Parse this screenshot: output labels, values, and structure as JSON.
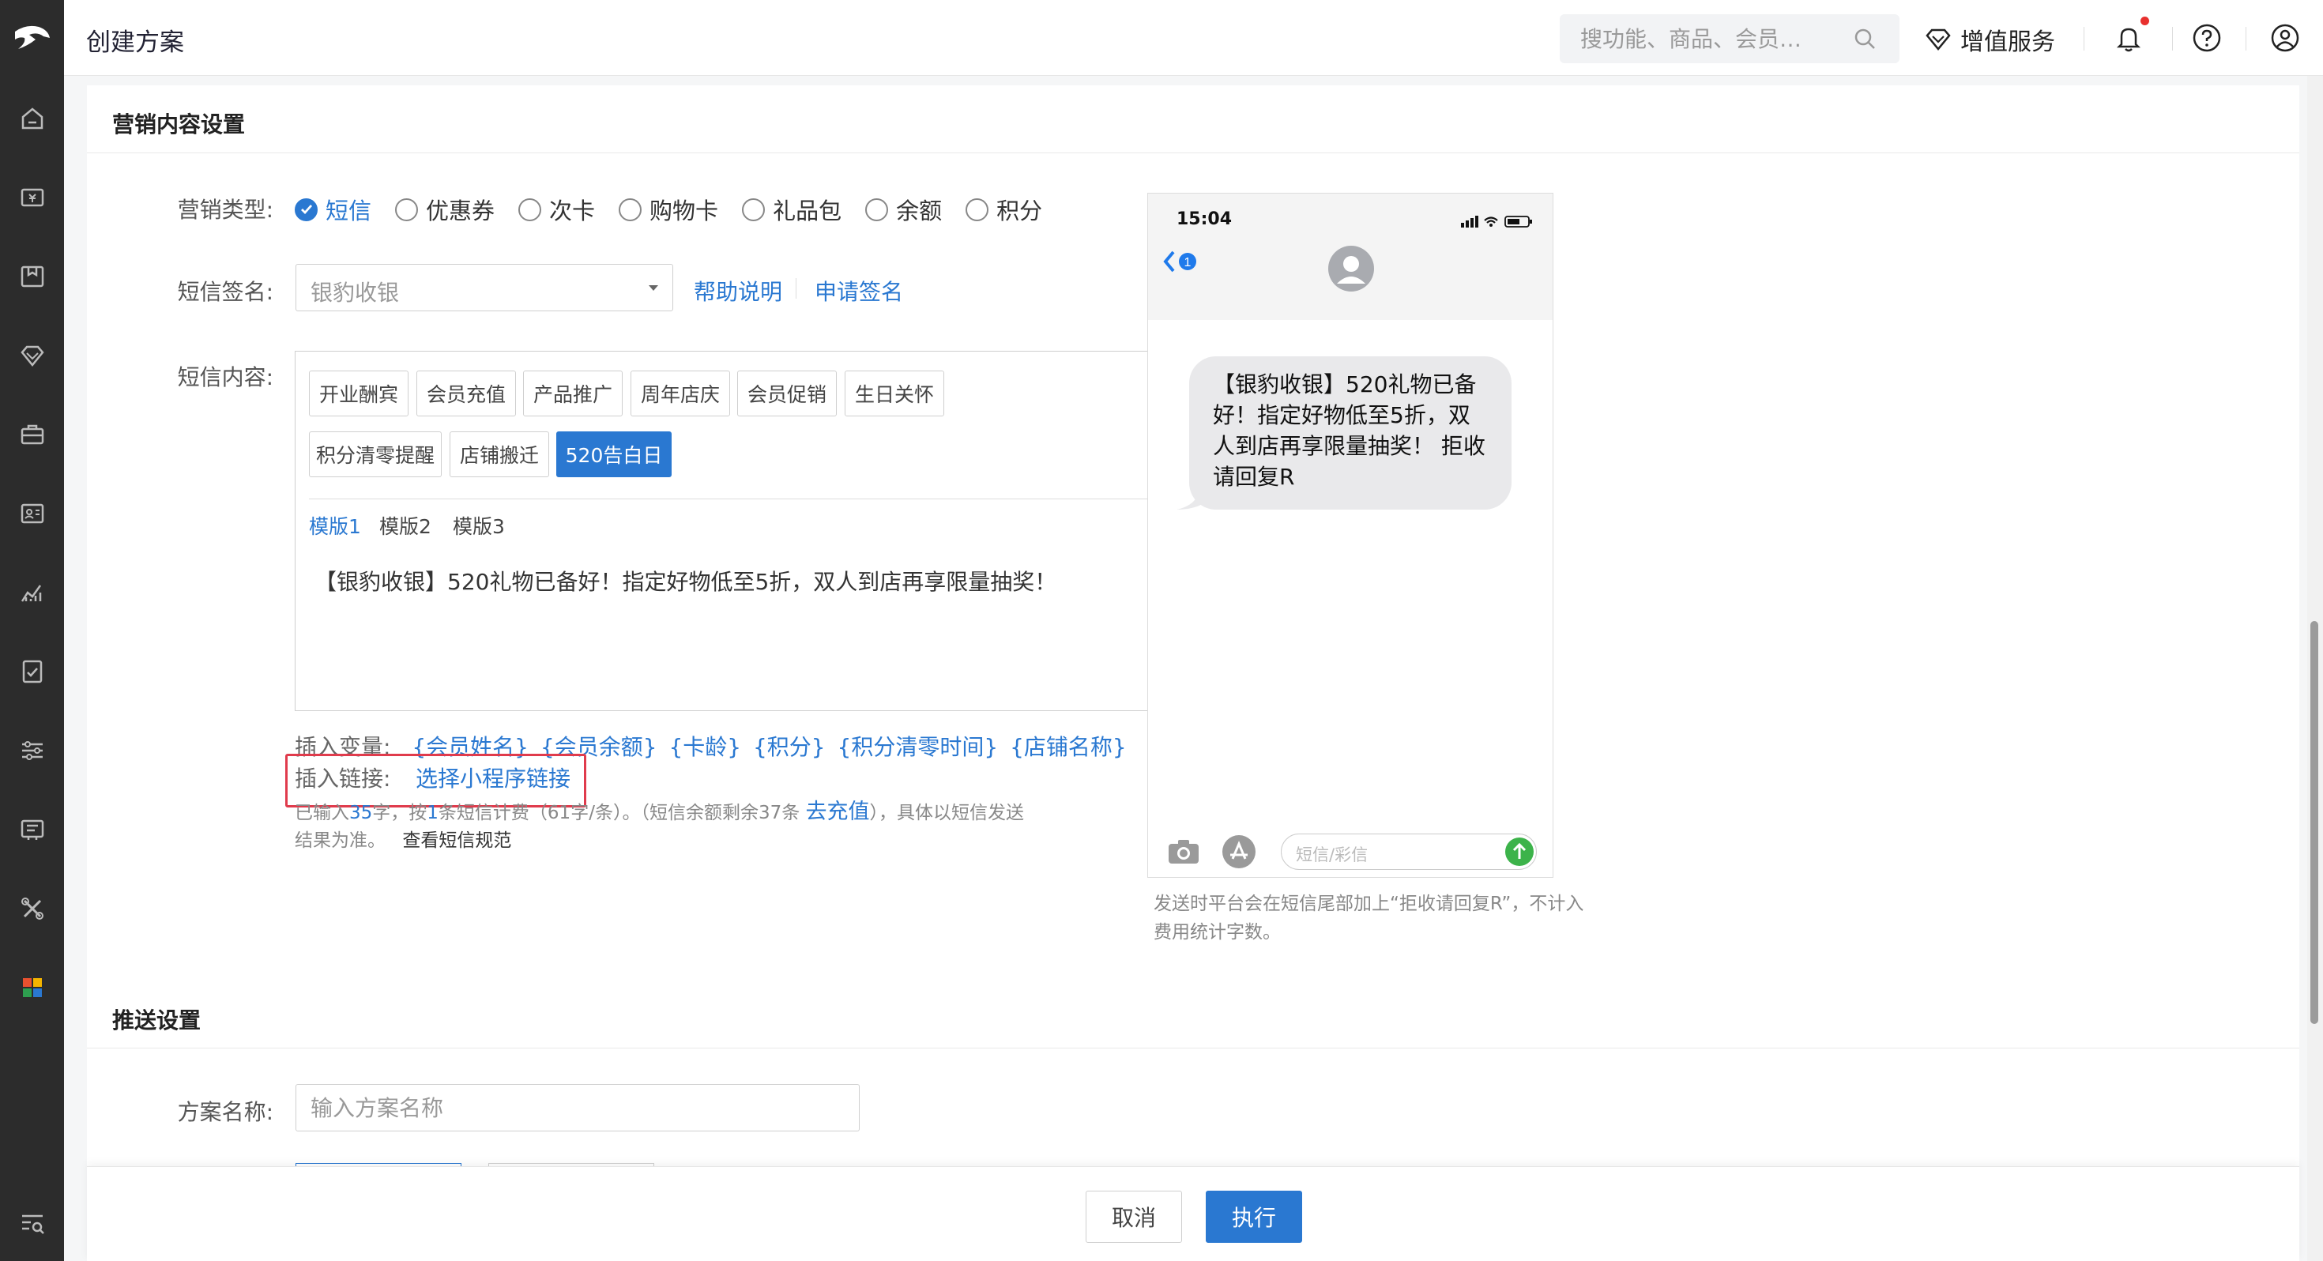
{
  "header": {
    "title": "创建方案",
    "search_placeholder": "搜功能、商品、会员…",
    "value_added_label": "增值服务"
  },
  "sidebar": {
    "icons": [
      "home-icon",
      "cashier-icon",
      "package-icon",
      "diamond-icon",
      "briefcase-icon",
      "member-card-icon",
      "chart-icon",
      "report-icon",
      "settings-sliders-icon",
      "order-icon",
      "tools-icon",
      "apps-icon",
      "search-list-icon"
    ]
  },
  "marketing": {
    "section_title": "营销内容设置",
    "type_label": "营销类型:",
    "types": [
      "短信",
      "优惠券",
      "次卡",
      "购物卡",
      "礼品包",
      "余额",
      "积分"
    ],
    "selected_type": "短信",
    "signature_label": "短信签名:",
    "signature_value": "银豹收银",
    "help_link": "帮助说明",
    "apply_signature_link": "申请签名",
    "content_label": "短信内容:",
    "tags": [
      "开业酬宾",
      "会员充值",
      "产品推广",
      "周年店庆",
      "会员促销",
      "生日关怀",
      "积分清零提醒",
      "店铺搬迁",
      "520告白日"
    ],
    "active_tag": "520告白日",
    "templates": [
      "模版1",
      "模版2",
      "模版3"
    ],
    "active_template": "模版1",
    "content_text": "【银豹收银】520礼物已备好！指定好物低至5折，双人到店再享限量抽奖！",
    "insert_var_label": "插入变量:",
    "variables": [
      "{会员姓名}",
      "{会员余额}",
      "{卡龄}",
      "{积分}",
      "{积分清零时间}",
      "{店铺名称}"
    ],
    "insert_link_label": "插入链接:",
    "insert_link_action": "选择小程序链接",
    "stats": {
      "part1": "已输入",
      "chars": "35",
      "part2": "字，按",
      "count": "1",
      "part3": "条短信计费（61字/条）。（短信余额剩余37条",
      "recharge": "去充值",
      "part4": "），具体以短信发送",
      "line2": "结果为准。",
      "spec_link": "查看短信规范"
    }
  },
  "preview": {
    "time": "15:04",
    "back_badge": "1",
    "message": "【银豹收银】520礼物已备好！指定好物低至5折，双人到店再享限量抽奖！ 拒收请回复R",
    "input_placeholder": "短信/彩信",
    "note": "发送时平台会在短信尾部加上“拒收请回复R”，不计入费用统计字数。"
  },
  "push": {
    "section_title": "推送设置",
    "name_label": "方案名称:",
    "name_placeholder": "输入方案名称"
  },
  "footer": {
    "cancel": "取消",
    "execute": "执行"
  },
  "colors": {
    "accent": "#2a78d1",
    "highlight_border": "#e03b4c",
    "sidebar_bg": "#2c2c2c"
  }
}
